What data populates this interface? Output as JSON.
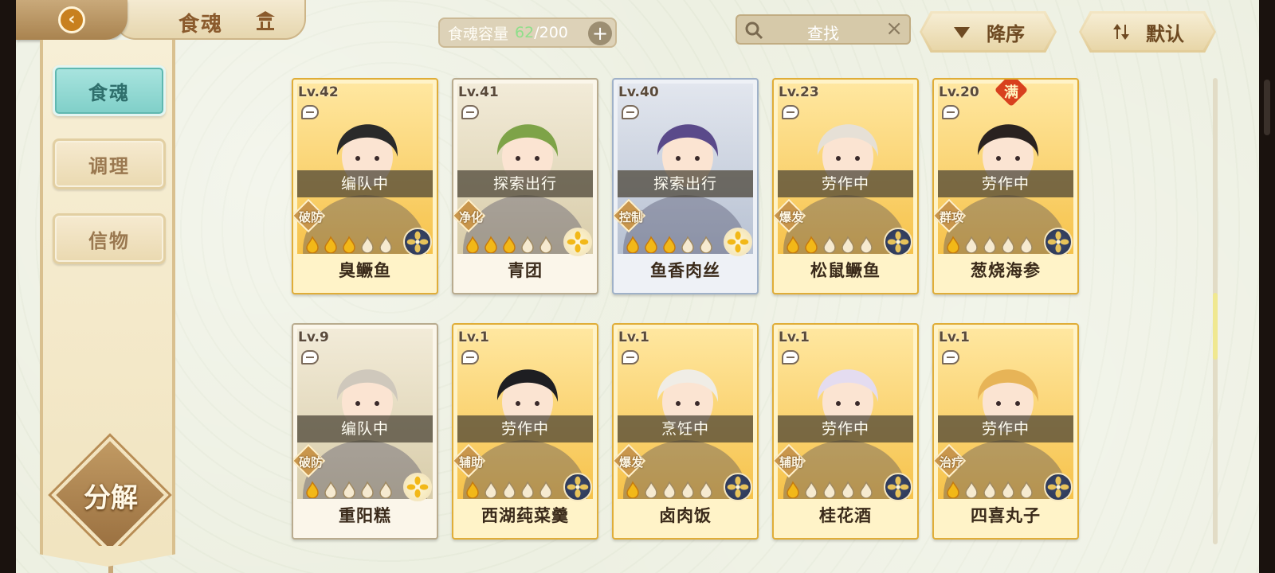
{
  "header": {
    "title": "食魂",
    "capacity_label": "食魂容量",
    "capacity_current": "62",
    "capacity_max": "/200",
    "search_placeholder": "查找",
    "sort_label": "降序",
    "default_label": "默认"
  },
  "sidebar": {
    "tabs": [
      {
        "label": "食魂",
        "active": true
      },
      {
        "label": "调理",
        "active": false
      },
      {
        "label": "信物",
        "active": false
      }
    ],
    "decompose_label": "分解"
  },
  "colors": {
    "accent_teal": "#7fcfc8",
    "card_gold": "#e0ad38",
    "status_bar": "#464032",
    "background": "#edf0e2"
  },
  "cards": [
    {
      "level": "Lv.42",
      "status": "编队中",
      "role": "破防",
      "stars": 3,
      "element": "dark",
      "name": "臭鳜鱼",
      "frame": "gold",
      "full": ""
    },
    {
      "level": "Lv.41",
      "status": "探索出行",
      "role": "净化",
      "stars": 3,
      "element": "light",
      "name": "青团",
      "frame": "white",
      "full": ""
    },
    {
      "level": "Lv.40",
      "status": "探索出行",
      "role": "控制",
      "stars": 3,
      "element": "light",
      "name": "鱼香肉丝",
      "frame": "blue",
      "full": ""
    },
    {
      "level": "Lv.23",
      "status": "劳作中",
      "role": "爆发",
      "stars": 2,
      "element": "dark",
      "name": "松鼠鳜鱼",
      "frame": "gold",
      "full": ""
    },
    {
      "level": "Lv.20",
      "status": "劳作中",
      "role": "群攻",
      "stars": 1,
      "element": "dark",
      "name": "葱烧海参",
      "frame": "gold",
      "full": "满"
    },
    {
      "level": "Lv.9",
      "status": "编队中",
      "role": "破防",
      "stars": 1,
      "element": "light",
      "name": "重阳糕",
      "frame": "white",
      "full": ""
    },
    {
      "level": "Lv.1",
      "status": "劳作中",
      "role": "辅助",
      "stars": 1,
      "element": "dark",
      "name": "西湖莼菜羹",
      "frame": "gold",
      "full": ""
    },
    {
      "level": "Lv.1",
      "status": "烹饪中",
      "role": "爆发",
      "stars": 1,
      "element": "dark",
      "name": "卤肉饭",
      "frame": "gold",
      "full": ""
    },
    {
      "level": "Lv.1",
      "status": "劳作中",
      "role": "辅助",
      "stars": 1,
      "element": "dark",
      "name": "桂花酒",
      "frame": "gold",
      "full": ""
    },
    {
      "level": "Lv.1",
      "status": "劳作中",
      "role": "治疗",
      "stars": 1,
      "element": "dark",
      "name": "四喜丸子",
      "frame": "gold",
      "full": ""
    }
  ]
}
